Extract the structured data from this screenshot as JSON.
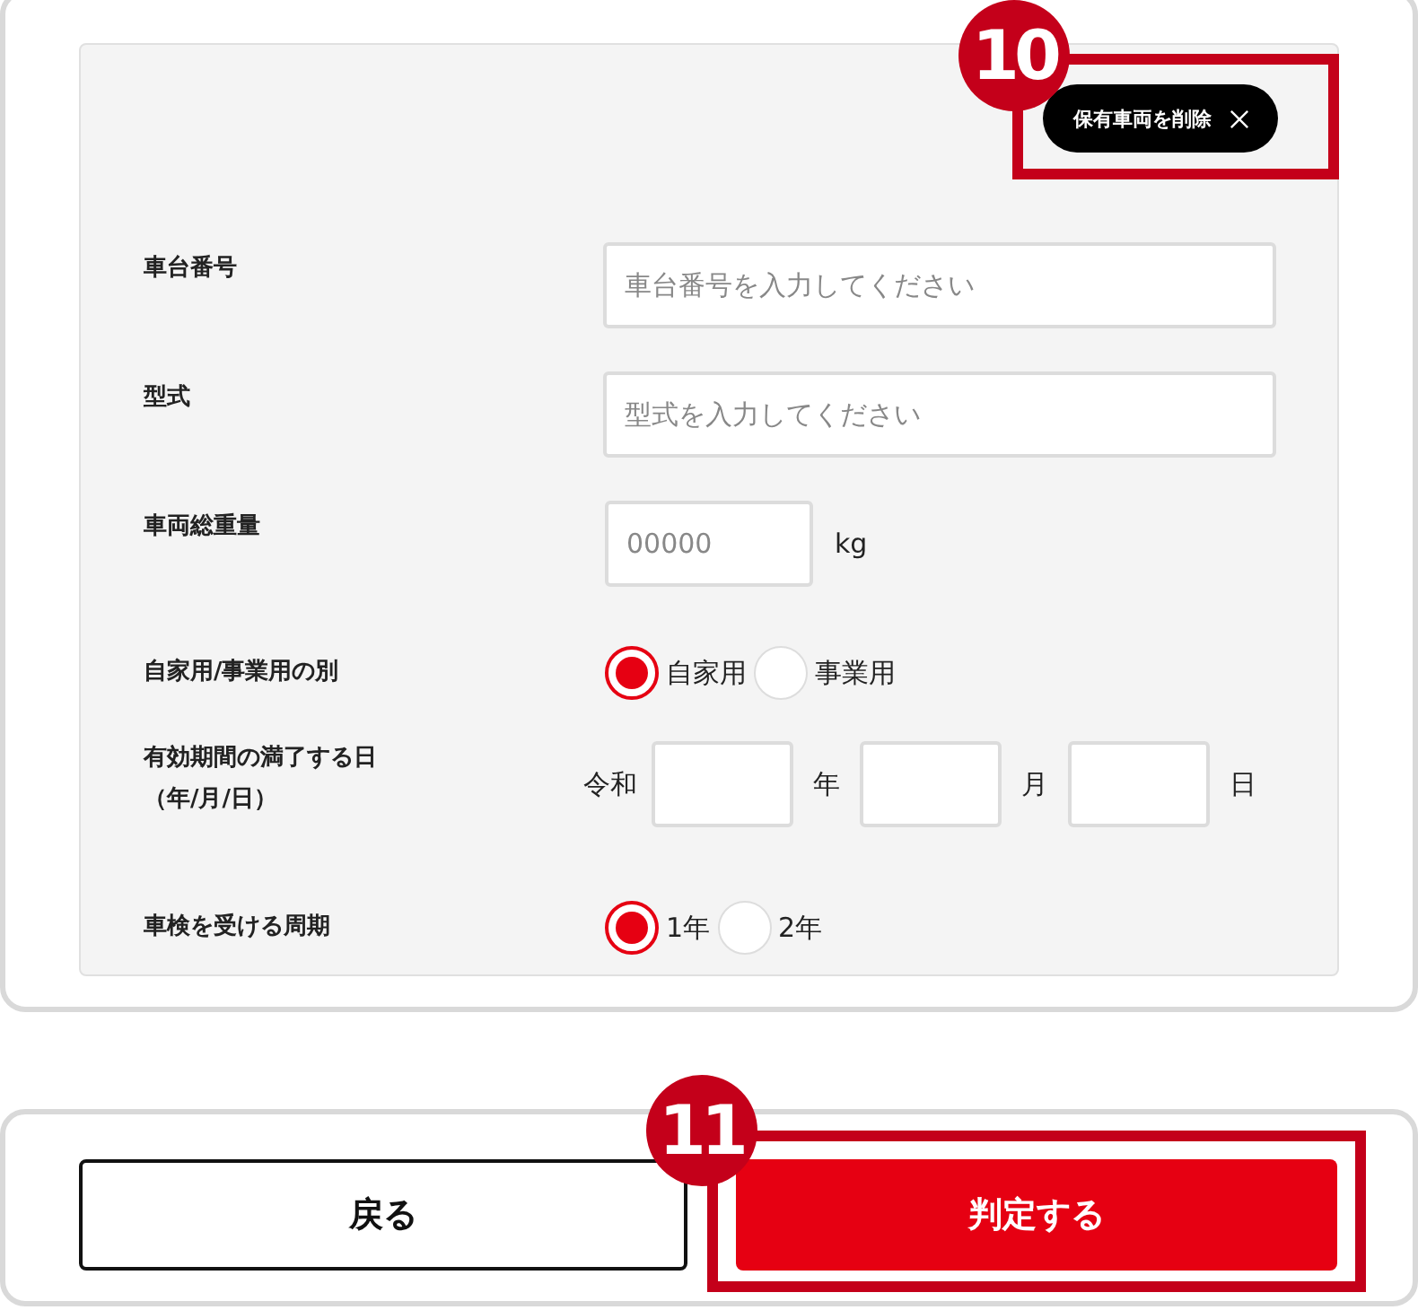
{
  "vehicle_card": {
    "delete_button": {
      "label": "保有車両を削除",
      "callout": "10"
    },
    "rows": [
      {
        "kind": "text",
        "label": "車台番号",
        "placeholder": "車台番号を入力してください"
      },
      {
        "kind": "text",
        "label": "型式",
        "placeholder": "型式を入力してください"
      },
      {
        "kind": "weight",
        "label": "車両総重量",
        "placeholder": "00000",
        "unit": "kg"
      },
      {
        "kind": "radio",
        "label": "自家用/事業用の別",
        "options": [
          {
            "label": "自家用",
            "selected": true
          },
          {
            "label": "事業用",
            "selected": false
          }
        ]
      },
      {
        "kind": "date",
        "label": "有効期間の満了する日",
        "sublabel": "（年/月/日）",
        "era": "令和",
        "parts": [
          "年",
          "月",
          "日"
        ]
      },
      {
        "kind": "radio",
        "label": "車検を受ける周期",
        "options": [
          {
            "label": "1年",
            "selected": true
          },
          {
            "label": "2年",
            "selected": false
          }
        ]
      }
    ]
  },
  "actions": [
    {
      "label": "戻る",
      "kind": "secondary"
    },
    {
      "label": "判定する",
      "kind": "primary",
      "callout": "11"
    }
  ]
}
